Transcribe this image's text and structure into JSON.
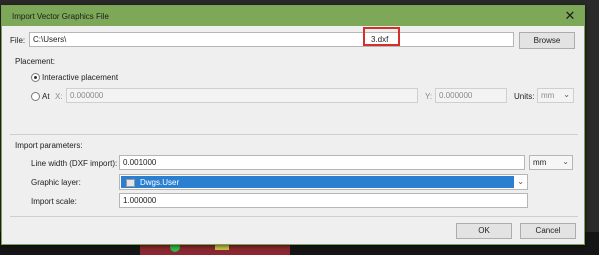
{
  "dialog": {
    "title": "Import Vector Graphics File",
    "close_glyph": "✕",
    "file_label": "File:",
    "file_path": "C:\\Users\\",
    "file_name": "3.dxf",
    "browse_label": "Browse",
    "placement": {
      "heading": "Placement:",
      "interactive_label": "Interactive placement",
      "at_label": "At",
      "x_label": "X:",
      "x_value": "0.000000",
      "y_label": "Y:",
      "y_value": "0.000000",
      "units_label": "Units:",
      "units_value": "mm"
    },
    "import": {
      "heading": "Import parameters:",
      "line_width_label": "Line width (DXF import):",
      "line_width_value": "0.001000",
      "line_width_units": "mm",
      "graphic_layer_label": "Graphic layer:",
      "graphic_layer_value": "Dwgs.User",
      "import_scale_label": "Import scale:",
      "import_scale_value": "1.000000"
    },
    "ok_label": "OK",
    "cancel_label": "Cancel",
    "colors": {
      "title_bar": "#7ca858",
      "highlight_box": "#d3302a",
      "selected_layer": "#2b7fd1"
    }
  }
}
